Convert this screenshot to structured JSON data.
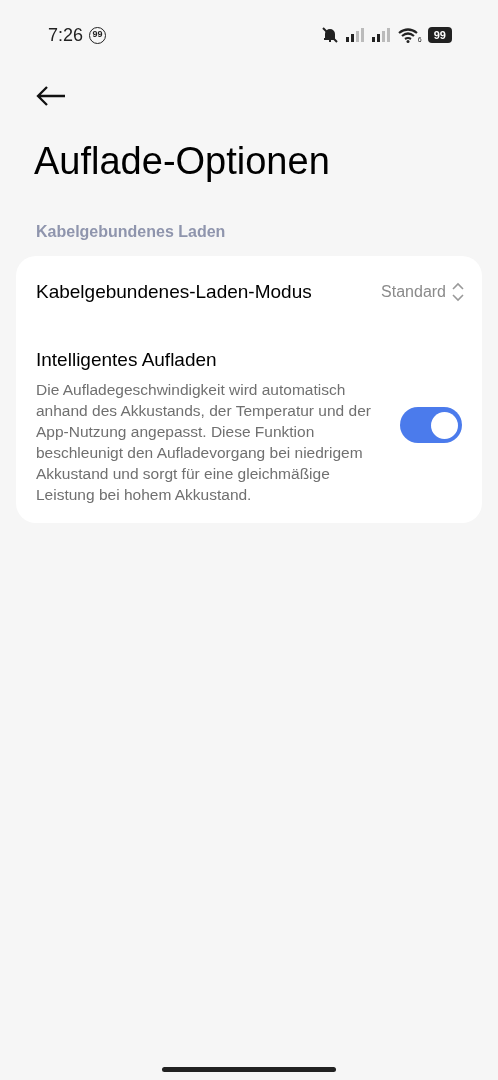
{
  "status_bar": {
    "time": "7:26",
    "notification_count": "99",
    "wifi_generation": "6",
    "battery": "99"
  },
  "title": "Auflade-Optionen",
  "section": {
    "header": "Kabelgebundenes Laden",
    "items": [
      {
        "kind": "select",
        "label": "Kabelgebundenes-Laden-Modus",
        "value": "Standard"
      },
      {
        "kind": "toggle",
        "label": "Intelligentes Aufladen",
        "description": "Die Aufladegeschwindigkeit wird automatisch anhand des Akkustands, der Temperatur und der App-Nutzung angepasst. Diese Funktion beschleunigt den Aufladevorgang bei niedrigem Akkustand und sorgt für eine gleichmäßige Leistung bei hohem Akkustand.",
        "on": true
      }
    ]
  }
}
